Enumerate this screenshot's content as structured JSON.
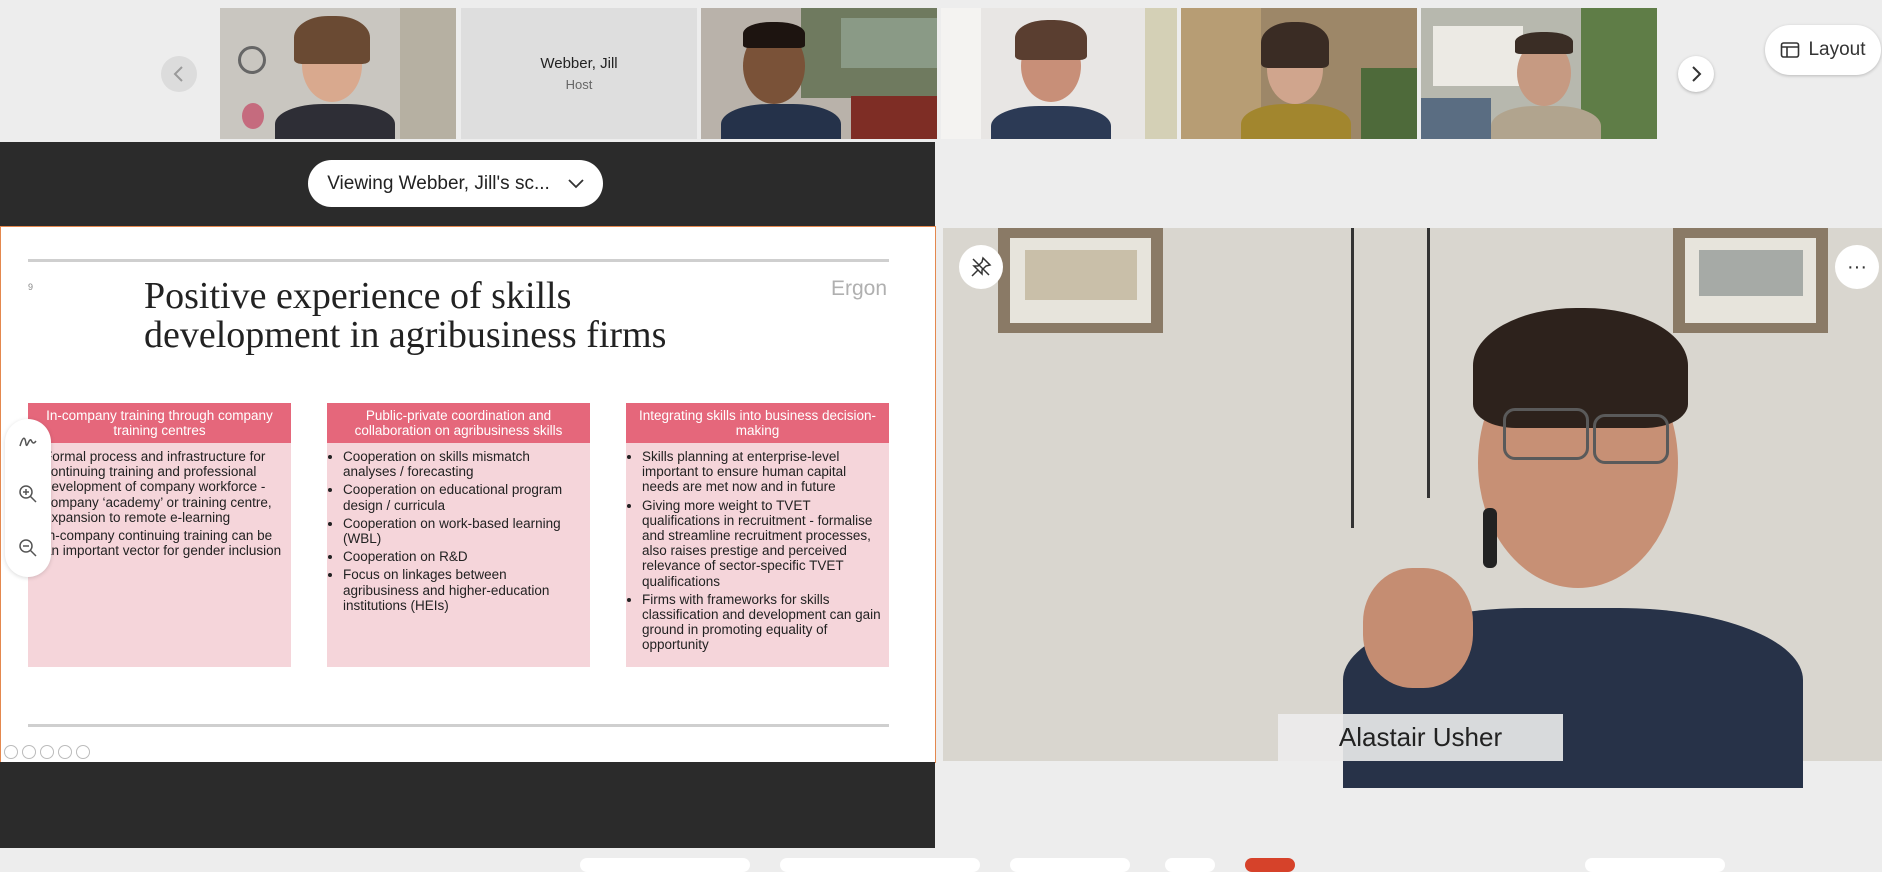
{
  "filmstrip": {
    "host_name": "Webber, Jill",
    "host_role": "Host",
    "layout_label": "Layout"
  },
  "share": {
    "viewing_label": "Viewing Webber, Jill's sc..."
  },
  "slide": {
    "number": "9",
    "title_line1": "Positive experience of skills",
    "title_line2": "development in agribusiness firms",
    "brand": "Ergon",
    "boxes": [
      {
        "heading": "In-company training through company training centres",
        "bullets": [
          "Formal process and infrastructure for continuing training and professional development of company workforce - company ‘academy’ or training centre, expansion to remote e-learning",
          "In-company continuing training can be an important vector for gender inclusion"
        ]
      },
      {
        "heading": "Public-private coordination and collaboration on agribusiness skills",
        "bullets": [
          "Cooperation on skills mismatch analyses / forecasting",
          "Cooperation on educational program design / curricula",
          "Cooperation on work-based learning (WBL)",
          "Cooperation on R&D",
          "Focus on linkages between agribusiness and higher-education institutions (HEIs)"
        ]
      },
      {
        "heading": "Integrating skills into business decision-making",
        "bullets": [
          "Skills planning at enterprise-level important to ensure human capital needs are met now and in future",
          "Giving more weight to TVET qualifications in recruitment - formalise and streamline recruitment processes, also raises prestige and perceived relevance of sector-specific TVET qualifications",
          "Firms with frameworks for skills classification and development can gain ground in promoting equality of opportunity"
        ]
      }
    ]
  },
  "speaker": {
    "name": "Alastair Usher",
    "more_label": "···"
  },
  "icons": {
    "prev": "chevron-left-icon",
    "next": "chevron-right-icon",
    "layout": "layout-icon",
    "dropdown": "chevron-down-icon",
    "annotate": "annotate-icon",
    "zoom_in": "zoom-in-icon",
    "zoom_out": "zoom-out-icon",
    "unpin": "unpin-icon",
    "more": "more-icon"
  },
  "colors": {
    "accent_pink": "#e5677b",
    "box_fill": "#f5d5da",
    "share_border": "#e4884e"
  }
}
